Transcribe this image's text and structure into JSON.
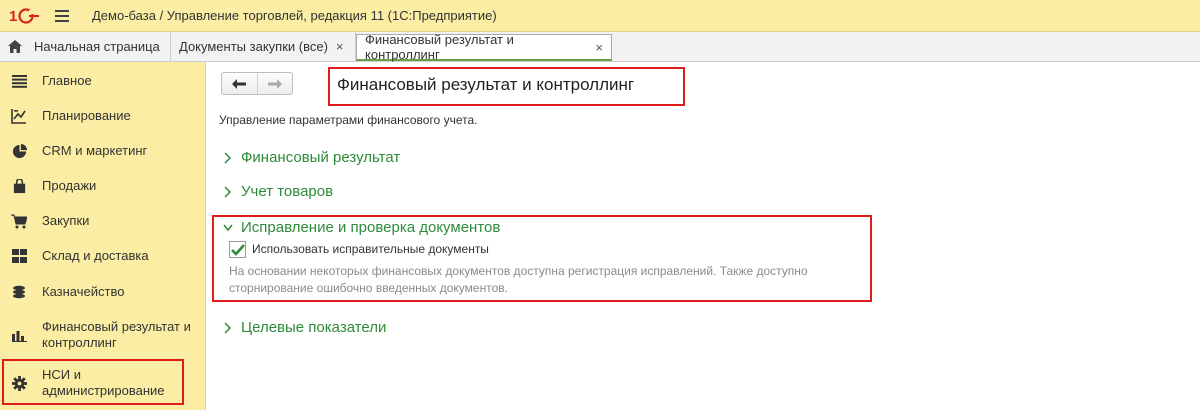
{
  "window": {
    "title": "Демо-база / Управление торговлей, редакция 11  (1С:Предприятие)"
  },
  "tabs": [
    {
      "label": "Начальная страница",
      "icon": "home-icon"
    },
    {
      "label": "Документы закупки (все)",
      "close": "×"
    },
    {
      "label": "Финансовый результат и контроллинг",
      "close": "×"
    }
  ],
  "sidebar": {
    "items": [
      {
        "label": "Главное",
        "icon": "menu-lines-icon"
      },
      {
        "label": "Планирование",
        "icon": "planning-chart-icon"
      },
      {
        "label": "CRM и маркетинг",
        "icon": "pie-chart-icon"
      },
      {
        "label": "Продажи",
        "icon": "shopping-bag-icon"
      },
      {
        "label": "Закупки",
        "icon": "cart-icon"
      },
      {
        "label": "Склад и доставка",
        "icon": "warehouse-grid-icon"
      },
      {
        "label": "Казначейство",
        "icon": "coins-icon"
      },
      {
        "label": "Финансовый результат и",
        "label2": "контроллинг",
        "icon": "bar-chart-icon"
      },
      {
        "label": "НСИ и",
        "label2": "администрирование",
        "icon": "gear-icon"
      }
    ]
  },
  "main": {
    "title": "Финансовый результат и контроллинг",
    "subtitle": "Управление параметрами финансового учета.",
    "groups": [
      {
        "label": "Финансовый результат",
        "expanded": false
      },
      {
        "label": "Учет товаров",
        "expanded": false
      },
      {
        "label": "Исправление и проверка документов",
        "expanded": true
      },
      {
        "label": "Целевые показатели",
        "expanded": false
      }
    ],
    "checkbox": {
      "label": "Использовать исправительные документы",
      "checked": true
    },
    "hint": "На основании некоторых финансовых документов доступна регистрация исправлений. Также доступно сторнирование ошибочно введенных документов."
  },
  "colors": {
    "accent": "#2e8b3a",
    "sidebar": "#fbeda3",
    "highlight": "#e01b1b"
  }
}
